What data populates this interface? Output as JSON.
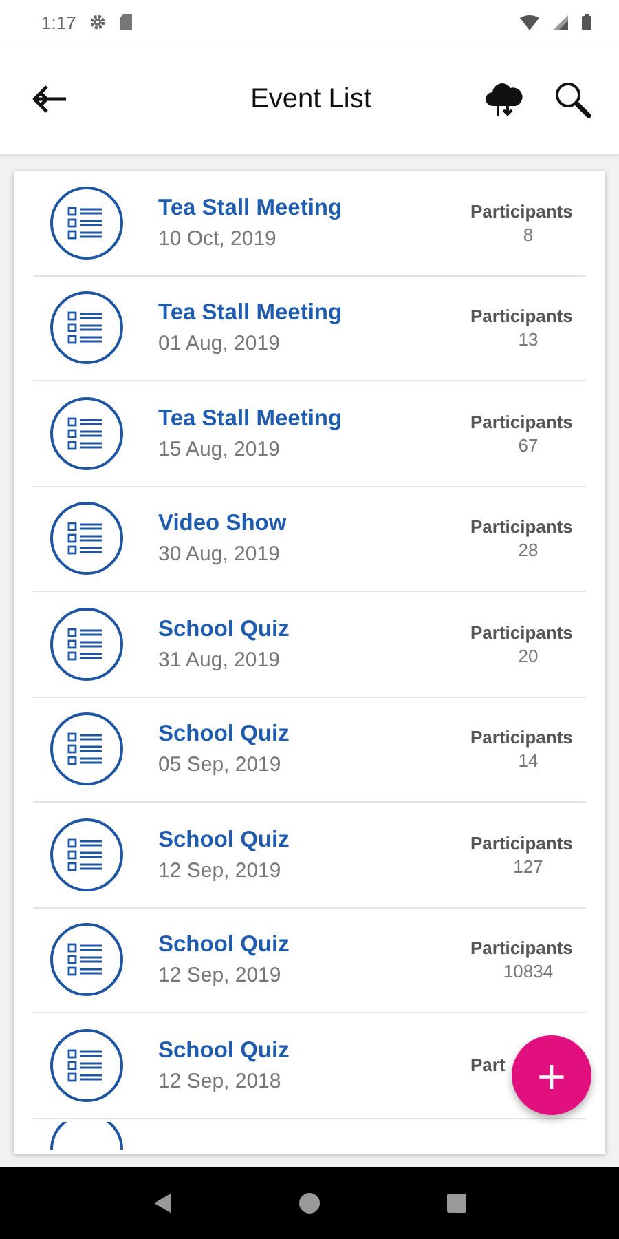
{
  "status_bar": {
    "time": "1:17"
  },
  "app_bar": {
    "title": "Event List"
  },
  "events": [
    {
      "title": "Tea Stall Meeting",
      "date": "10 Oct, 2019",
      "label": "Participants",
      "count": "8"
    },
    {
      "title": "Tea Stall Meeting",
      "date": "01 Aug, 2019",
      "label": "Participants",
      "count": "13"
    },
    {
      "title": "Tea Stall Meeting",
      "date": "15 Aug, 2019",
      "label": "Participants",
      "count": "67"
    },
    {
      "title": "Video Show",
      "date": "30 Aug, 2019",
      "label": "Participants",
      "count": "28"
    },
    {
      "title": "School Quiz",
      "date": "31 Aug, 2019",
      "label": "Participants",
      "count": "20"
    },
    {
      "title": "School Quiz",
      "date": "05 Sep, 2019",
      "label": "Participants",
      "count": "14"
    },
    {
      "title": "School Quiz",
      "date": "12 Sep, 2019",
      "label": "Participants",
      "count": "127"
    },
    {
      "title": "School Quiz",
      "date": "12 Sep, 2019",
      "label": "Participants",
      "count": "10834"
    },
    {
      "title": "School Quiz",
      "date": "12 Sep, 2018",
      "label": "Part"
    }
  ],
  "more_rows_below": true,
  "fab": {
    "label": "+"
  }
}
